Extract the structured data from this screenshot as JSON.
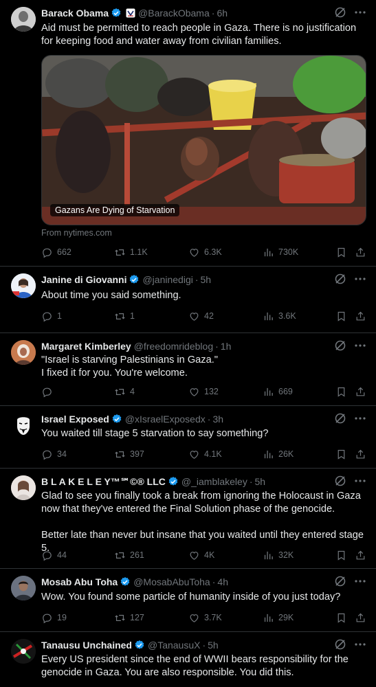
{
  "colors": {
    "background": "#000000",
    "verified": "#1d9bf0",
    "text": "#e7e9ea",
    "muted": "#71767b",
    "divider": "#2f3336"
  },
  "icons": {
    "verified": "verified-badge-icon",
    "grok": "grok-icon",
    "more": "more-icon",
    "reply": "reply-icon",
    "retweet": "retweet-icon",
    "like": "like-icon",
    "views": "views-icon",
    "bookmark": "bookmark-icon",
    "share": "share-icon"
  },
  "tweets": [
    {
      "name": "Barack Obama",
      "handle": "@BarackObama",
      "time": "6h",
      "text": [
        "Aid must be permitted to reach people in Gaza. There is no justification for keeping food and water away from civilian families."
      ],
      "card": {
        "caption": "Gazans Are Dying of Starvation",
        "source": "From nytimes.com"
      },
      "stats": {
        "replies": "662",
        "retweets": "1.1K",
        "likes": "6.3K",
        "views": "730K"
      }
    },
    {
      "name": "Janine di Giovanni",
      "handle": "@janinedigi",
      "time": "5h",
      "text": [
        "About time you said something."
      ],
      "stats": {
        "replies": "1",
        "retweets": "1",
        "likes": "42",
        "views": "3.6K"
      }
    },
    {
      "name": "Margaret Kimberley",
      "handle": "@freedomrideblog",
      "time": "1h",
      "text": [
        "\"Israel is starving Palestinians in Gaza.\"",
        "I fixed it for you. You're welcome."
      ],
      "stats": {
        "replies": "",
        "retweets": "4",
        "likes": "132",
        "views": "669"
      }
    },
    {
      "name": "Israel Exposed",
      "handle": "@xIsraelExposedx",
      "time": "3h",
      "text": [
        "You waited till stage 5 starvation to say something?"
      ],
      "stats": {
        "replies": "34",
        "retweets": "397",
        "likes": "4.1K",
        "views": "26K"
      }
    },
    {
      "name": "B L A K E L E Y™℠©® LLC",
      "handle": "@_iamblakeley",
      "time": "5h",
      "text": [
        "Glad to see you finally took a break from ignoring the Holocaust in Gaza now that they've entered the Final Solution phase of the genocide.",
        "",
        "Better late than never but insane that you waited until they entered stage 5."
      ],
      "stats": {
        "replies": "44",
        "retweets": "261",
        "likes": "4K",
        "views": "32K"
      }
    },
    {
      "name": "Mosab Abu Toha",
      "handle": "@MosabAbuToha",
      "time": "4h",
      "text": [
        "Wow. You found some particle of humanity inside of you just today?"
      ],
      "stats": {
        "replies": "19",
        "retweets": "127",
        "likes": "3.7K",
        "views": "29K"
      }
    },
    {
      "name": "Tanausu Unchained",
      "handle": "@TanausuX",
      "time": "5h",
      "text": [
        "Every US president since the end of WWII bears responsibility for the genocide in Gaza. You are also responsible. You did this."
      ],
      "stats": null
    }
  ]
}
